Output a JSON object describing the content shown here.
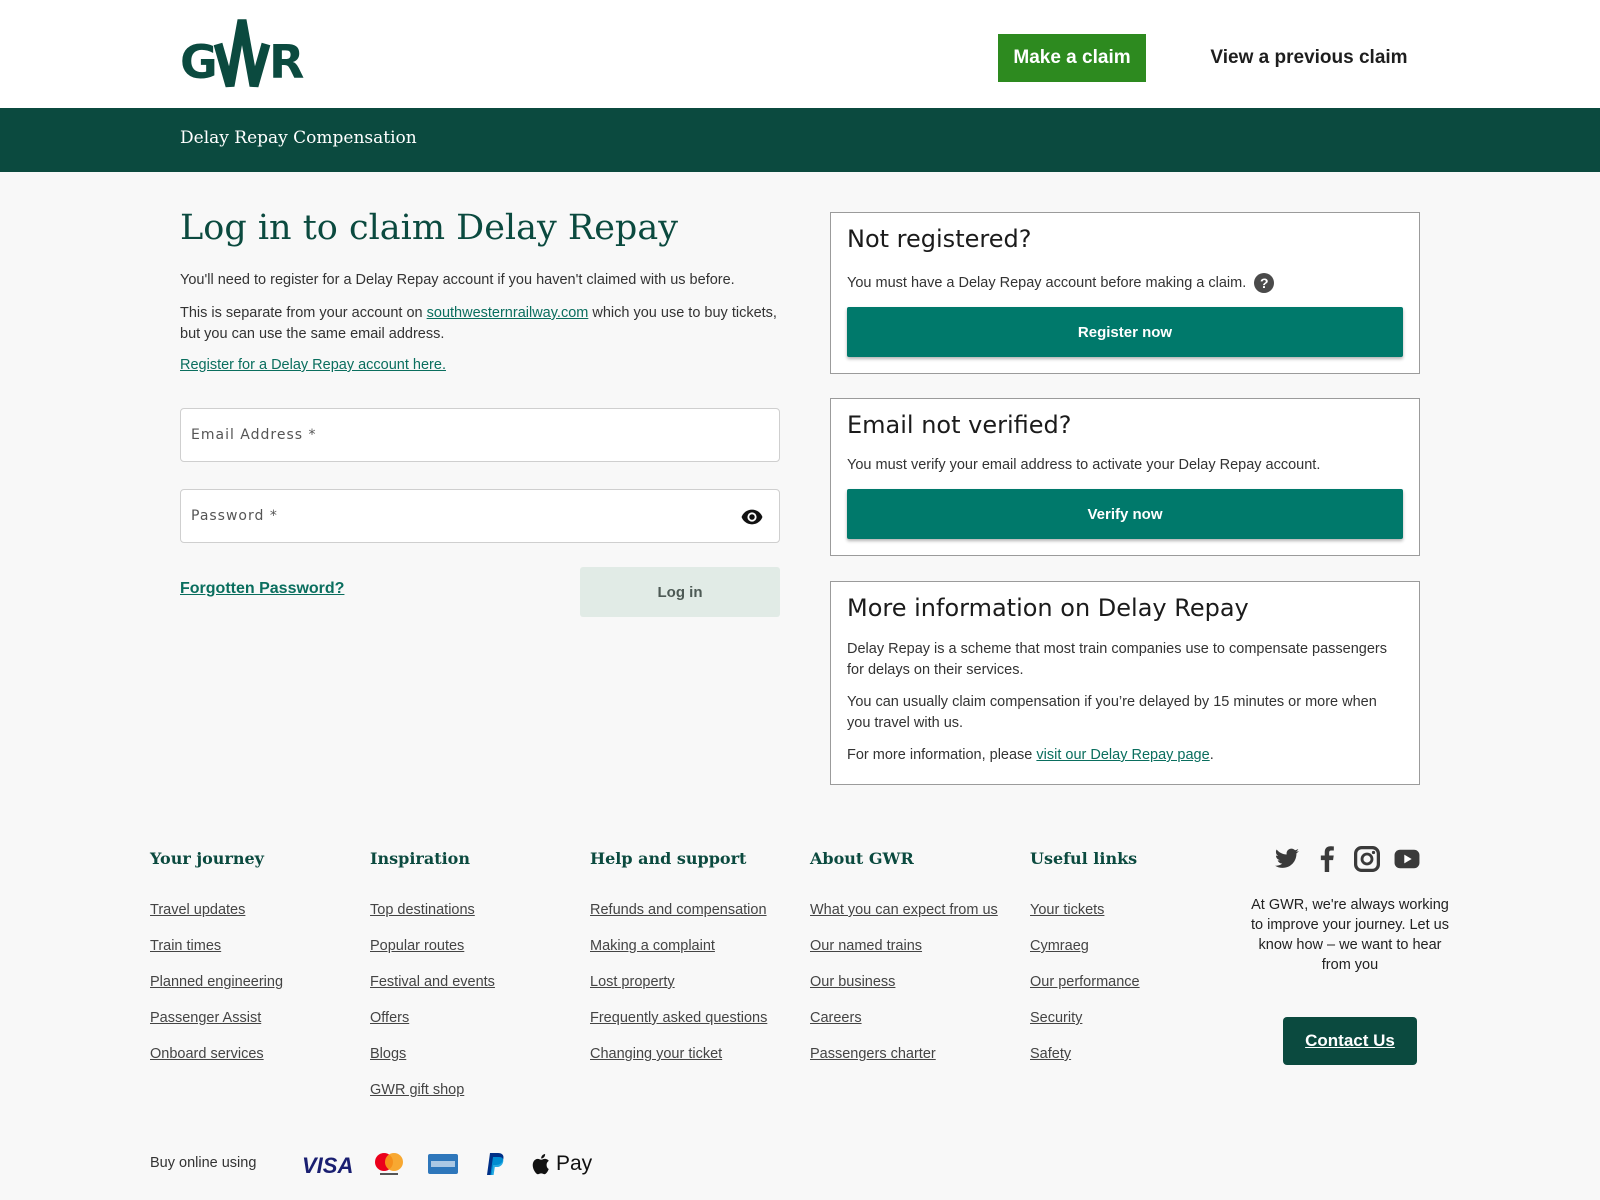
{
  "header": {
    "make_claim": "Make a claim",
    "view_previous": "View a previous claim",
    "section_title": "Delay Repay Compensation"
  },
  "login": {
    "title": "Log in to claim Delay Repay",
    "intro": "You'll need to register for a Delay Repay account if you haven't claimed with us before.",
    "separate_before": "This is separate from your account on ",
    "separate_link": "southwesternrailway.com",
    "separate_after": " which you use to buy tickets, but you can use the same email address.",
    "register_link": "Register for a Delay Repay account here.",
    "email_placeholder": "Email Address *",
    "password_placeholder": "Password *",
    "forgot_link": "Forgotten Password?",
    "login_button": "Log in"
  },
  "cards": {
    "not_registered": {
      "title": "Not registered?",
      "text": "You must have a Delay Repay account before making a claim.",
      "help": "?",
      "button": "Register now"
    },
    "not_verified": {
      "title": "Email not verified?",
      "text": "You must verify your email address to activate your Delay Repay account.",
      "button": "Verify now"
    },
    "more_info": {
      "title": "More information on Delay Repay",
      "p1": "Delay Repay is a scheme that most train companies use to compensate passengers for delays on their services.",
      "p2": "You can usually claim compensation if you’re delayed by 15 minutes or more when you travel with us.",
      "p3_before": "For more information, please ",
      "p3_link": "visit our Delay Repay page",
      "p3_after": "."
    }
  },
  "footer": {
    "columns": [
      {
        "heading": "Your journey",
        "links": [
          "Travel updates",
          "Train times",
          "Planned engineering",
          "Passenger Assist",
          "Onboard services"
        ]
      },
      {
        "heading": "Inspiration",
        "links": [
          "Top destinations",
          "Popular routes",
          "Festival and events",
          "Offers",
          "Blogs",
          "GWR gift shop"
        ]
      },
      {
        "heading": "Help and support",
        "links": [
          "Refunds and compensation",
          "Making a complaint",
          "Lost property",
          "Frequently asked questions",
          "Changing your ticket"
        ]
      },
      {
        "heading": "About GWR",
        "links": [
          "What you can expect from us",
          "Our named trains",
          "Our business",
          "Careers",
          "Passengers charter"
        ]
      },
      {
        "heading": "Useful links",
        "links": [
          "Your tickets",
          "Cymraeg",
          "Our performance",
          "Security",
          "Safety"
        ]
      }
    ],
    "social_icons": [
      "twitter-icon",
      "facebook-icon",
      "instagram-icon",
      "youtube-icon"
    ],
    "feedback_text": "At GWR, we're always working to improve your journey. Let us know how – we want to hear from you",
    "contact_button": "Contact Us",
    "buy_online": "Buy online using",
    "payment_methods": [
      "VISA",
      "Mastercard",
      "American Express",
      "PayPal",
      "Pay"
    ]
  },
  "colors": {
    "brand_dark_green": "#0b4a3f",
    "claim_green": "#2d8a1f",
    "teal_button": "#00796b",
    "link_teal": "#0a6e5e"
  }
}
